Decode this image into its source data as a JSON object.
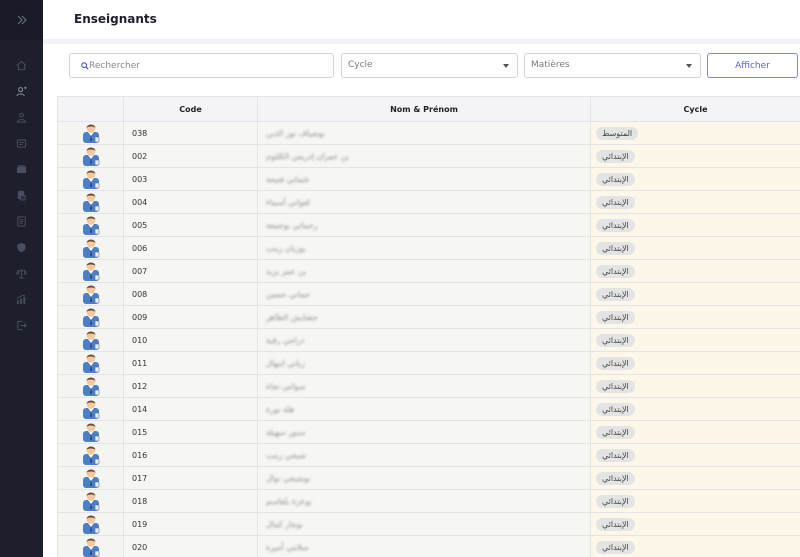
{
  "page": {
    "title": "Enseignants"
  },
  "sidebar": {
    "toggle_icon": "chevrons-right-icon",
    "items": [
      {
        "icon": "home-icon"
      },
      {
        "icon": "teacher-icon",
        "active": true
      },
      {
        "icon": "students-icon"
      },
      {
        "icon": "notebook-icon"
      },
      {
        "icon": "books-icon"
      },
      {
        "icon": "document-icon"
      },
      {
        "icon": "list-icon"
      },
      {
        "icon": "shield-icon"
      },
      {
        "icon": "scale-icon"
      },
      {
        "icon": "chart-icon"
      },
      {
        "icon": "logout-icon"
      }
    ]
  },
  "filters": {
    "search_placeholder": "Rechercher",
    "cycle_placeholder": "Cycle",
    "matieres_placeholder": "Matières",
    "afficher_label": "Afficher"
  },
  "table": {
    "columns": [
      "",
      "Code",
      "Nom & Prénom",
      "Cycle"
    ],
    "rows": [
      {
        "code": "038",
        "name": "بوضياف نور الدين",
        "cycle": "المتوسط"
      },
      {
        "code": "002",
        "name": "بن عمران إدريس الكلثوم",
        "cycle": "الإبتدائي"
      },
      {
        "code": "003",
        "name": "عثماني فتيحة",
        "cycle": "الإبتدائي"
      },
      {
        "code": "004",
        "name": "لعواني أسماء",
        "cycle": "الإبتدائي"
      },
      {
        "code": "005",
        "name": "رحماني بوجمعة",
        "cycle": "الإبتدائي"
      },
      {
        "code": "006",
        "name": "بوزيان زينب",
        "cycle": "الإبتدائي"
      },
      {
        "code": "007",
        "name": "بن عمر يزيد",
        "cycle": "الإبتدائي"
      },
      {
        "code": "008",
        "name": "حماني حسين",
        "cycle": "الإبتدائي"
      },
      {
        "code": "009",
        "name": "حشايش الطاهر",
        "cycle": "الإبتدائي"
      },
      {
        "code": "010",
        "name": "دراجي رقية",
        "cycle": "الإبتدائي"
      },
      {
        "code": "011",
        "name": "زياني ابتهال",
        "cycle": "الإبتدائي"
      },
      {
        "code": "012",
        "name": "سواس نجاة",
        "cycle": "الإبتدائي"
      },
      {
        "code": "014",
        "name": "هلة نورة",
        "cycle": "الإبتدائي"
      },
      {
        "code": "015",
        "name": "سنور سهيلة",
        "cycle": "الإبتدائي"
      },
      {
        "code": "016",
        "name": "شيخي زينب",
        "cycle": "الإبتدائي"
      },
      {
        "code": "017",
        "name": "بوشيخي نوال",
        "cycle": "الإبتدائي"
      },
      {
        "code": "018",
        "name": "بوعزة بلقاسم",
        "cycle": "الإبتدائي"
      },
      {
        "code": "019",
        "name": "بوجار كمال",
        "cycle": "الإبتدائي"
      },
      {
        "code": "020",
        "name": "سلامي أميرة",
        "cycle": "الإبتدائي"
      }
    ]
  },
  "colors": {
    "sidebar_bg": "#1e1f2d",
    "accent": "#5b63c7",
    "cycle_cell_bg": "#fdf7ea"
  }
}
